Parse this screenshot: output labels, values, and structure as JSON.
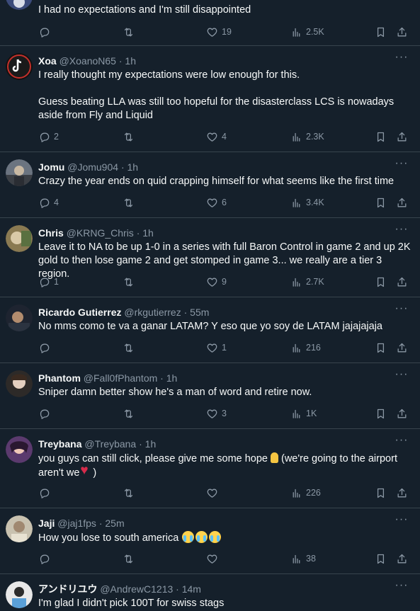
{
  "icons": {
    "reply": "reply-icon",
    "retweet": "retweet-icon",
    "like": "heart-icon",
    "views": "views-icon",
    "bookmark": "bookmark-icon",
    "share": "share-icon",
    "more": "more-icon"
  },
  "colors": {
    "background": "#15202b",
    "muted": "#8b98a5",
    "divider": "#38444d"
  },
  "tweets": [
    {
      "name": "",
      "handle": "",
      "time": "",
      "text": "I had no expectations and I'm still disappointed",
      "replies": "",
      "retweets": "",
      "likes": "19",
      "views": "2.5K"
    },
    {
      "name": "Xoa",
      "handle": "@XoanoN65",
      "time": "· 1h",
      "text": "I really thought my expectations were low enough for this.\n\nGuess beating LLA was still too hopeful for the disasterclass LCS is nowadays aside from Fly and Liquid",
      "replies": "2",
      "retweets": "",
      "likes": "4",
      "views": "2.3K"
    },
    {
      "name": "Jomu",
      "handle": "@Jomu904",
      "time": "· 1h",
      "text": "Crazy the year ends on quid crapping himself for what seems like the first time",
      "replies": "4",
      "retweets": "",
      "likes": "6",
      "views": "3.4K"
    },
    {
      "name": "Chris",
      "handle": "@KRNG_Chris",
      "time": "· 1h",
      "text": "Leave it to NA to be up 1-0 in a series with full Baron Control in game 2 and up 2K gold to then lose game 2 and get stomped in game 3... we really are a tier 3 region.",
      "replies": "1",
      "retweets": "",
      "likes": "9",
      "views": "2.7K"
    },
    {
      "name": "Ricardo Gutierrez",
      "handle": "@rkgutierrez",
      "time": "· 55m",
      "text": "No mms como te va a ganar LATAM? Y eso que yo soy de LATAM jajajajaja",
      "replies": "",
      "retweets": "",
      "likes": "1",
      "views": "216"
    },
    {
      "name": "Phantom",
      "handle": "@Fall0fPhantom",
      "time": "· 1h",
      "text": "Sniper damn better show he's a man of word and retire now.",
      "replies": "",
      "retweets": "",
      "likes": "3",
      "views": "1K"
    },
    {
      "name": "Treybana",
      "handle": "@Treybana",
      "time": "· 1h",
      "text_a": "you guys can still click, please give me some hope",
      "text_b": "(we're going to the airport aren't we",
      "text_c": ")",
      "replies": "",
      "retweets": "",
      "likes": "",
      "views": "226"
    },
    {
      "name": "Jaji",
      "handle": "@jaj1fps",
      "time": "· 25m",
      "text": "How you lose to south america",
      "replies": "",
      "retweets": "",
      "likes": "",
      "views": "38"
    },
    {
      "name": "アンドリユウ",
      "handle": "@AndrewC1213",
      "time": "· 14m",
      "text": "I'm glad I didn't pick 100T for swiss stags",
      "replies": "",
      "retweets": "",
      "likes": "",
      "views": ""
    }
  ]
}
